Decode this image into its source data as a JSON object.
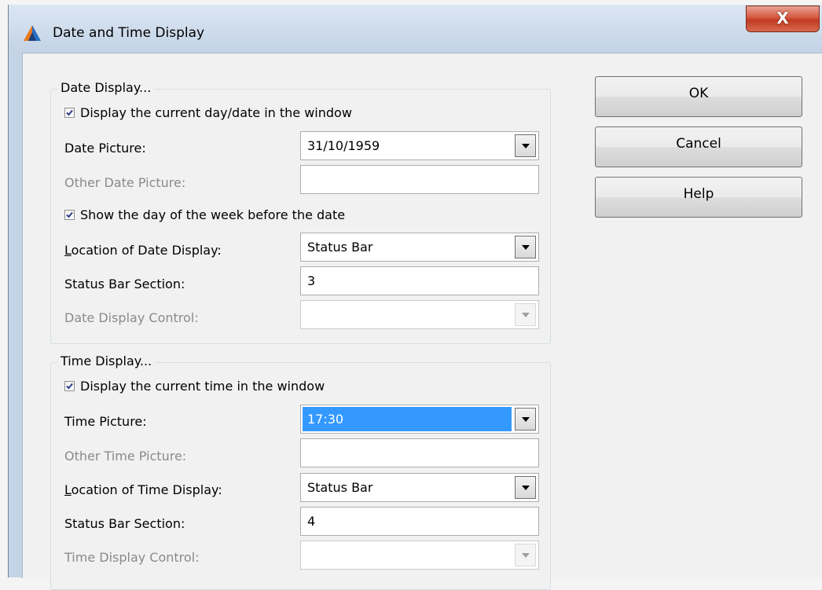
{
  "window": {
    "title": "Date and Time Display",
    "close_label": "X"
  },
  "buttons": {
    "ok": "OK",
    "cancel": "Cancel",
    "help": "Help"
  },
  "date_group": {
    "title": "Date Display...",
    "display_current_date": {
      "label": "Display the current day/date in the window",
      "checked": true
    },
    "date_picture": {
      "label": "Date Picture:",
      "value": "31/10/1959"
    },
    "other_date_picture": {
      "label": "Other Date Picture:",
      "value": ""
    },
    "show_day_of_week": {
      "label": "Show the day of the week before the date",
      "checked": true
    },
    "location": {
      "label_mnemonic": "L",
      "label_rest": "ocation of Date Display:",
      "value": "Status Bar"
    },
    "status_bar_section": {
      "label": "Status Bar Section:",
      "value": "3"
    },
    "display_control": {
      "label": "Date Display Control:",
      "value": ""
    }
  },
  "time_group": {
    "title": "Time Display...",
    "display_current_time": {
      "label": "Display the current time in the window",
      "checked": true
    },
    "time_picture": {
      "label": "Time Picture:",
      "value": "17:30"
    },
    "other_time_picture": {
      "label": "Other Time Picture:",
      "value": ""
    },
    "location": {
      "label_mnemonic": "L",
      "label_rest": "ocation of Time Display:",
      "value": "Status Bar"
    },
    "status_bar_section": {
      "label": "Status Bar Section:",
      "value": "4"
    },
    "display_control": {
      "label": "Time Display Control:",
      "value": ""
    }
  },
  "colors": {
    "selection": "#3399ff",
    "close_button": "#c13a21",
    "title_bar": "#c4d4e6"
  }
}
